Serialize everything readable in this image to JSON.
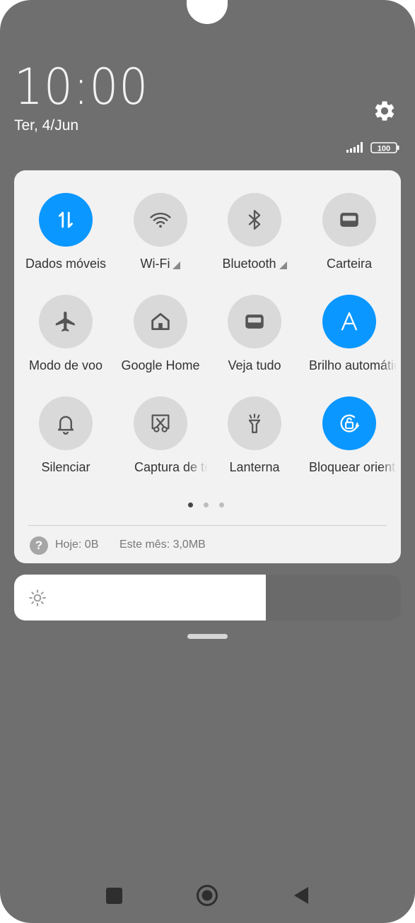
{
  "lockscreen": {
    "time": "10:00",
    "date": "Ter, 4/Jun",
    "battery": "100"
  },
  "quick_settings": {
    "tiles": [
      {
        "label": "Dados móveis",
        "icon": "mobile-data-icon",
        "active": true
      },
      {
        "label": "Wi-Fi",
        "icon": "wifi-icon",
        "active": false,
        "has_expand": true
      },
      {
        "label": "Bluetooth",
        "icon": "bluetooth-icon",
        "active": false,
        "has_expand": true
      },
      {
        "label": "Carteira",
        "icon": "wallet-icon",
        "active": false
      },
      {
        "label": "Modo de voo",
        "icon": "airplane-icon",
        "active": false
      },
      {
        "label": "Google Home",
        "icon": "home-icon",
        "active": false
      },
      {
        "label": "Veja tudo",
        "icon": "wallet-icon",
        "active": false
      },
      {
        "label": "Brilho automático",
        "icon": "auto-brightness-icon",
        "active": true
      },
      {
        "label": "Silenciar",
        "icon": "bell-icon",
        "active": false
      },
      {
        "label": "Captura de tela",
        "icon": "screenshot-icon",
        "active": false
      },
      {
        "label": "Lanterna",
        "icon": "flashlight-icon",
        "active": false
      },
      {
        "label": "Bloquear orientação",
        "icon": "rotation-lock-icon",
        "active": true
      }
    ],
    "page_indicator": {
      "pages": 3,
      "current": 1
    },
    "data_usage": {
      "today": "Hoje: 0B",
      "this_month": "Este mês: 3,0MB"
    }
  },
  "brightness": {
    "level_fraction": 0.65
  },
  "colors": {
    "active_tile": "#0a97ff",
    "inactive_tile": "#d9d9d9",
    "panel": "#f2f2f2",
    "scrim": "#6f6f6f"
  },
  "navigation": {
    "buttons": [
      "recents-icon",
      "home-icon",
      "back-icon"
    ]
  }
}
